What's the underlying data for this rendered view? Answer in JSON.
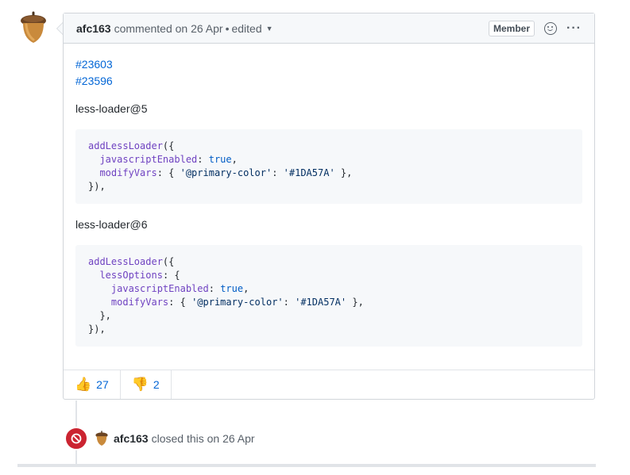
{
  "comment": {
    "author": "afc163",
    "action": "commented on 26 Apr",
    "separator": "•",
    "edited": "edited",
    "badge": "Member",
    "more": "···",
    "links": [
      "#23603",
      "#23596"
    ],
    "section1_label": "less-loader@5",
    "section2_label": "less-loader@6",
    "code1": {
      "l1_fn": "addLessLoader",
      "l1_rest": "({",
      "l2_prop": "javascriptEnabled",
      "l2_mid": ": ",
      "l2_val": "true",
      "l2_end": ",",
      "l3_prop": "modifyVars",
      "l3_mid": ": { ",
      "l3_key": "'@primary-color'",
      "l3_colon": ": ",
      "l3_val": "'#1DA57A'",
      "l3_end": " },",
      "l4": "}),"
    },
    "code2": {
      "l1_fn": "addLessLoader",
      "l1_rest": "({",
      "l2_prop": "lessOptions",
      "l2_rest": ": {",
      "l3_prop": "javascriptEnabled",
      "l3_mid": ": ",
      "l3_val": "true",
      "l3_end": ",",
      "l4_prop": "modifyVars",
      "l4_mid": ": { ",
      "l4_key": "'@primary-color'",
      "l4_colon": ": ",
      "l4_val": "'#1DA57A'",
      "l4_end": " },",
      "l5": "},",
      "l6": "}),"
    },
    "reactions": [
      {
        "emoji": "👍",
        "count": "27",
        "icon": "thumbs-up-icon"
      },
      {
        "emoji": "👎",
        "count": "2",
        "icon": "thumbs-down-icon"
      }
    ]
  },
  "closed_event": {
    "author": "afc163",
    "text": "closed this on 26 Apr",
    "status_color": "#cb2431"
  }
}
